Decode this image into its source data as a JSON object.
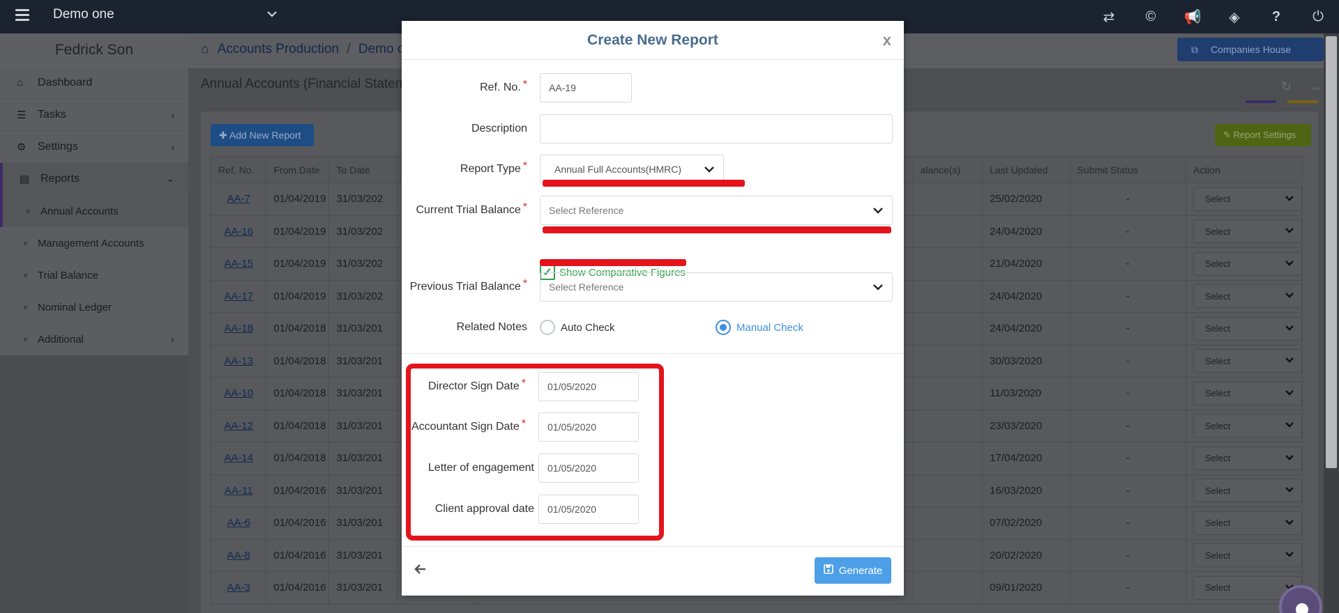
{
  "topbar": {
    "company": "Demo one",
    "icons": [
      "transfer-icon",
      "copyright-icon",
      "megaphone-icon",
      "tag-icon",
      "help-icon",
      "power-icon"
    ]
  },
  "sidebar": {
    "user_name": "Fedrick Son",
    "items": [
      {
        "label": "Dashboard",
        "icon": "dashboard-icon"
      },
      {
        "label": "Tasks",
        "icon": "tasks-icon"
      },
      {
        "label": "Settings",
        "icon": "gear-icon"
      },
      {
        "label": "Reports",
        "icon": "report-icon"
      }
    ],
    "report_subitems": [
      "Annual Accounts",
      "Management Accounts",
      "Trial Balance",
      "Nominal Ledger"
    ],
    "additional": "Additional"
  },
  "main": {
    "breadcrumb": {
      "home": "Accounts Production",
      "current": "Demo on"
    },
    "companies_house": "Companies House",
    "page_title": "Annual Accounts (Financial Stateme",
    "add_report": "Add New Report",
    "report_settings": "Report Settings",
    "table": {
      "headers": [
        "Ref. No.",
        "From Date",
        "To Date",
        "",
        "",
        "alance(s)",
        "Last Updated",
        "Submit Status",
        "Action"
      ],
      "rows": [
        {
          "ref": "AA-7",
          "from": "01/04/2019",
          "to": "31/03/202",
          "updated": "25/02/2020",
          "status": "-",
          "action": "Select"
        },
        {
          "ref": "AA-16",
          "from": "01/04/2019",
          "to": "31/03/202",
          "updated": "24/04/2020",
          "status": "-",
          "action": "Select"
        },
        {
          "ref": "AA-15",
          "from": "01/04/2019",
          "to": "31/03/202",
          "updated": "21/04/2020",
          "status": "-",
          "action": "Select"
        },
        {
          "ref": "AA-17",
          "from": "01/04/2019",
          "to": "31/03/202",
          "updated": "24/04/2020",
          "status": "-",
          "action": "Select"
        },
        {
          "ref": "AA-18",
          "from": "01/04/2018",
          "to": "31/03/201",
          "updated": "24/04/2020",
          "status": "-",
          "action": "Select"
        },
        {
          "ref": "AA-13",
          "from": "01/04/2018",
          "to": "31/03/201",
          "updated": "30/03/2020",
          "status": "-",
          "action": "Select"
        },
        {
          "ref": "AA-10",
          "from": "01/04/2018",
          "to": "31/03/201",
          "updated": "11/03/2020",
          "status": "-",
          "action": "Select"
        },
        {
          "ref": "AA-12",
          "from": "01/04/2018",
          "to": "31/03/201",
          "updated": "23/03/2020",
          "status": "-",
          "action": "Select"
        },
        {
          "ref": "AA-14",
          "from": "01/04/2018",
          "to": "31/03/201",
          "updated": "17/04/2020",
          "status": "-",
          "action": "Select"
        },
        {
          "ref": "AA-11",
          "from": "01/04/2016",
          "to": "31/03/201",
          "updated": "16/03/2020",
          "status": "-",
          "action": "Select"
        },
        {
          "ref": "AA-6",
          "from": "01/04/2016",
          "to": "31/03/201",
          "updated": "07/02/2020",
          "status": "-",
          "action": "Select"
        },
        {
          "ref": "AA-8",
          "from": "01/04/2016",
          "to": "31/03/201",
          "updated": "20/02/2020",
          "status": "-",
          "action": "Select"
        },
        {
          "ref": "AA-3",
          "from": "01/04/2016",
          "to": "31/03/201",
          "updated": "09/01/2020",
          "status": "-",
          "action": "Select"
        }
      ]
    }
  },
  "modal": {
    "title": "Create New Report",
    "close": "x",
    "ref_no": {
      "label": "Ref. No.",
      "value": "AA-19"
    },
    "description": {
      "label": "Description",
      "value": ""
    },
    "report_type": {
      "label": "Report Type",
      "value": "Annual Full Accounts(HMRC)"
    },
    "current_tb": {
      "label": "Current Trial Balance",
      "placeholder": "Select Reference"
    },
    "show_comparative": {
      "label": "Show Comparative Figures",
      "checked": true
    },
    "previous_tb": {
      "label": "Previous Trial Balance",
      "placeholder": "Select Reference"
    },
    "related_notes": {
      "label": "Related Notes",
      "auto": "Auto Check",
      "manual": "Manual Check",
      "selected": "manual"
    },
    "director_sign": {
      "label": "Director Sign Date",
      "value": "01/05/2020"
    },
    "accountant_sign": {
      "label": "Accountant Sign Date",
      "value": "01/05/2020"
    },
    "letter_engagement": {
      "label": "Letter of engagement",
      "value": "01/05/2020"
    },
    "client_approval": {
      "label": "Client approval date",
      "value": "01/05/2020"
    },
    "generate": "Generate",
    "required_mark": "*"
  }
}
